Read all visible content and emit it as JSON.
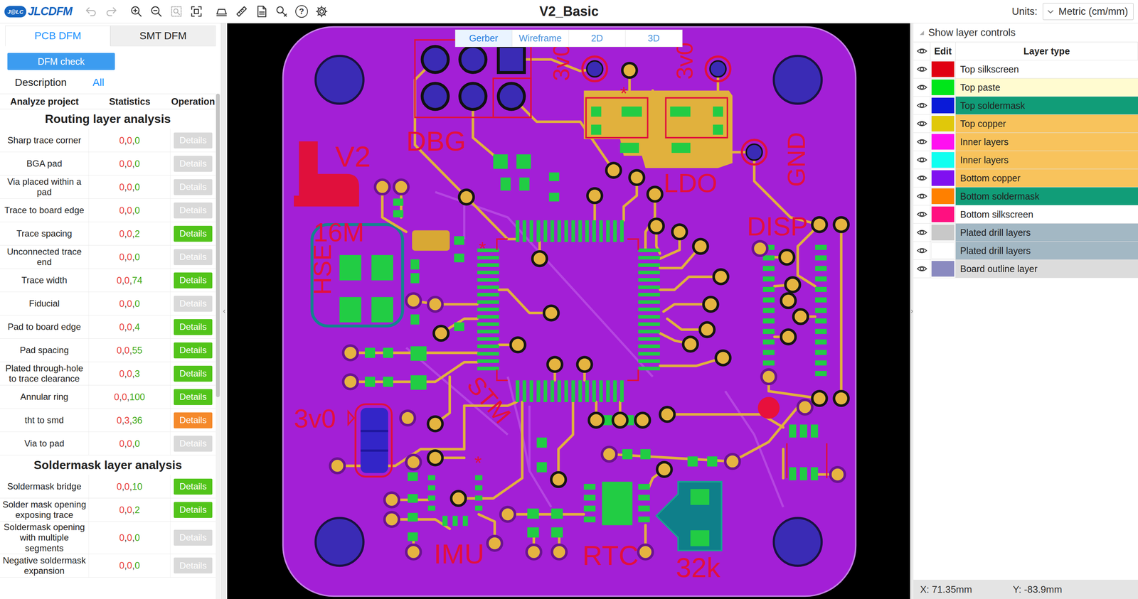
{
  "toolbar": {
    "logo": {
      "badge": "J@LC",
      "name": "JLCDFM"
    },
    "title": "V2_Basic",
    "help_glyph": "?",
    "units_label": "Units:",
    "units_value": "Metric (cm/mm)"
  },
  "left_panel": {
    "tabs": [
      {
        "label": "PCB DFM",
        "selected": true
      },
      {
        "label": "SMT DFM",
        "selected": false
      }
    ],
    "check_button": "DFM check",
    "filter": {
      "label": "Description",
      "value": "All"
    },
    "columns": [
      "Analyze project",
      "Statistics",
      "Operation"
    ],
    "separator": ", ",
    "sections": [
      {
        "title": "Routing layer analysis",
        "rows": [
          {
            "name": "Sharp trace corner",
            "stats": [
              "0",
              "0",
              "0"
            ],
            "action": "Details",
            "status": "disabled"
          },
          {
            "name": "BGA pad",
            "stats": [
              "0",
              "0",
              "0"
            ],
            "action": "Details",
            "status": "disabled"
          },
          {
            "name": "Via placed within a pad",
            "stats": [
              "0",
              "0",
              "0"
            ],
            "action": "Details",
            "status": "disabled"
          },
          {
            "name": "Trace to board edge",
            "stats": [
              "0",
              "0",
              "0"
            ],
            "action": "Details",
            "status": "disabled"
          },
          {
            "name": "Trace spacing",
            "stats": [
              "0",
              "0",
              "2"
            ],
            "action": "Details",
            "status": "ok"
          },
          {
            "name": "Unconnected trace end",
            "stats": [
              "0",
              "0",
              "0"
            ],
            "action": "Details",
            "status": "disabled"
          },
          {
            "name": "Trace width",
            "stats": [
              "0",
              "0",
              "74"
            ],
            "action": "Details",
            "status": "ok"
          },
          {
            "name": "Fiducial",
            "stats": [
              "0",
              "0",
              "0"
            ],
            "action": "Details",
            "status": "disabled"
          },
          {
            "name": "Pad to board edge",
            "stats": [
              "0",
              "0",
              "4"
            ],
            "action": "Details",
            "status": "ok"
          },
          {
            "name": "Pad spacing",
            "stats": [
              "0",
              "0",
              "55"
            ],
            "action": "Details",
            "status": "ok"
          },
          {
            "name": "Plated through-hole to trace clearance",
            "stats": [
              "0",
              "0",
              "3"
            ],
            "action": "Details",
            "status": "ok"
          },
          {
            "name": "Annular ring",
            "stats": [
              "0",
              "0",
              "100"
            ],
            "action": "Details",
            "status": "ok"
          },
          {
            "name": "tht to smd",
            "stats": [
              "0",
              "3",
              "36"
            ],
            "action": "Details",
            "status": "warning"
          },
          {
            "name": "Via to pad",
            "stats": [
              "0",
              "0",
              "0"
            ],
            "action": "Details",
            "status": "disabled"
          }
        ]
      },
      {
        "title": "Soldermask layer analysis",
        "rows": [
          {
            "name": "Soldermask bridge",
            "stats": [
              "0",
              "0",
              "10"
            ],
            "action": "Details",
            "status": "ok"
          },
          {
            "name": "Solder mask opening exposing trace",
            "stats": [
              "0",
              "0",
              "2"
            ],
            "action": "Details",
            "status": "ok"
          },
          {
            "name": "Soldermask opening with multiple segments",
            "stats": [
              "0",
              "0",
              "0"
            ],
            "action": "Details",
            "status": "disabled"
          },
          {
            "name": "Negative soldermask expansion",
            "stats": [
              "0",
              "0",
              "0"
            ],
            "action": "Details",
            "status": "disabled"
          }
        ]
      }
    ]
  },
  "view_tabs": [
    {
      "label": "Gerber",
      "selected": true
    },
    {
      "label": "Wireframe",
      "selected": false
    },
    {
      "label": "2D",
      "selected": false
    },
    {
      "label": "3D",
      "selected": false
    }
  ],
  "board": {
    "labels": [
      "DBG",
      "V2",
      "16M",
      "HSE",
      "STM",
      "IMU",
      "RTC",
      "32k",
      "LDO",
      "DISP",
      "GND",
      "3v0",
      "3v0",
      "3v0",
      "*",
      "*",
      "*"
    ]
  },
  "layers": {
    "toggle": "Show layer controls",
    "columns": [
      "Edit",
      "Layer type"
    ],
    "rows": [
      {
        "name": "Top silkscreen",
        "visible": true,
        "swatch": "#e00012",
        "highlight": "#ffffff"
      },
      {
        "name": "Top paste",
        "visible": true,
        "swatch": "#00e61a",
        "highlight": "#fffbd0"
      },
      {
        "name": "Top soldermask",
        "visible": true,
        "swatch": "#0a1ad8",
        "highlight": "#119d78"
      },
      {
        "name": "Top copper",
        "visible": true,
        "swatch": "#e0c80a",
        "highlight": "#f8c35c"
      },
      {
        "name": "Inner layers",
        "visible": true,
        "swatch": "#ff10f0",
        "highlight": "#f8c35c"
      },
      {
        "name": "Inner layers",
        "visible": true,
        "swatch": "#10fff0",
        "highlight": "#f8c35c"
      },
      {
        "name": "Bottom copper",
        "visible": true,
        "swatch": "#8010f0",
        "highlight": "#f8c35c"
      },
      {
        "name": "Bottom soldermask",
        "visible": true,
        "swatch": "#ff8000",
        "highlight": "#119d78"
      },
      {
        "name": "Bottom silkscreen",
        "visible": true,
        "swatch": "#ff1080",
        "highlight": "#ffffff"
      },
      {
        "name": "Plated drill layers",
        "visible": true,
        "swatch": "#c8c8c8",
        "highlight": "#a3b8c4"
      },
      {
        "name": "Plated drill layers",
        "visible": true,
        "swatch": "#ffffff",
        "highlight": "#a3b8c4"
      },
      {
        "name": "Board outline layer",
        "visible": true,
        "swatch": "#8a8ac0",
        "highlight": "#dcdcdc"
      }
    ]
  },
  "status_bar": {
    "x": "X: 71.35mm",
    "y": "Y: -83.9mm"
  }
}
